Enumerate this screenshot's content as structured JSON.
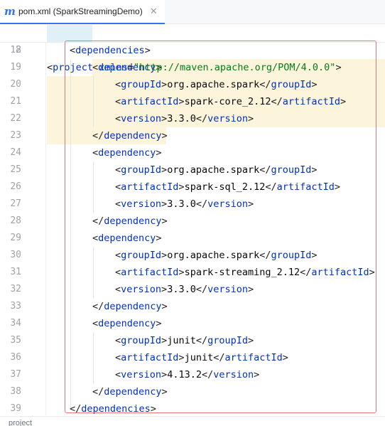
{
  "tab": {
    "icon": "maven-icon",
    "icon_glyph": "m",
    "title": "pom.xml (SparkStreamingDemo)",
    "close_glyph": "✕"
  },
  "sticky_line": {
    "number": "2",
    "open": "<",
    "tag": "project",
    "attr": "xmlns",
    "eq": "=",
    "value": "\"http://maven.apache.org/POM/4.0.0\"",
    "close": ">"
  },
  "lines": [
    {
      "n": "18",
      "tag": "dependencies",
      "kind": "open",
      "indent": 1
    },
    {
      "n": "19",
      "tag": "dependency",
      "kind": "open",
      "indent": 2
    },
    {
      "n": "20",
      "tag": "groupId",
      "kind": "value",
      "text": "org.apache.spark",
      "indent": 3
    },
    {
      "n": "21",
      "tag": "artifactId",
      "kind": "value",
      "text": "spark-core_2.12",
      "indent": 3
    },
    {
      "n": "22",
      "tag": "version",
      "kind": "value",
      "text": "3.3.0",
      "indent": 3
    },
    {
      "n": "23",
      "tag": "dependency",
      "kind": "close",
      "indent": 2
    },
    {
      "n": "24",
      "tag": "dependency",
      "kind": "open",
      "indent": 2
    },
    {
      "n": "25",
      "tag": "groupId",
      "kind": "value",
      "text": "org.apache.spark",
      "indent": 3
    },
    {
      "n": "26",
      "tag": "artifactId",
      "kind": "value",
      "text": "spark-sql_2.12",
      "indent": 3
    },
    {
      "n": "27",
      "tag": "version",
      "kind": "value",
      "text": "3.3.0",
      "indent": 3
    },
    {
      "n": "28",
      "tag": "dependency",
      "kind": "close",
      "indent": 2
    },
    {
      "n": "29",
      "tag": "dependency",
      "kind": "open",
      "indent": 2
    },
    {
      "n": "30",
      "tag": "groupId",
      "kind": "value",
      "text": "org.apache.spark",
      "indent": 3
    },
    {
      "n": "31",
      "tag": "artifactId",
      "kind": "value",
      "text": "spark-streaming_2.12",
      "indent": 3
    },
    {
      "n": "32",
      "tag": "version",
      "kind": "value",
      "text": "3.3.0",
      "indent": 3
    },
    {
      "n": "33",
      "tag": "dependency",
      "kind": "close",
      "indent": 2
    },
    {
      "n": "34",
      "tag": "dependency",
      "kind": "open",
      "indent": 2
    },
    {
      "n": "35",
      "tag": "groupId",
      "kind": "value",
      "text": "junit",
      "indent": 3
    },
    {
      "n": "36",
      "tag": "artifactId",
      "kind": "value",
      "text": "junit",
      "indent": 3
    },
    {
      "n": "37",
      "tag": "version",
      "kind": "value",
      "text": "4.13.2",
      "indent": 3
    },
    {
      "n": "38",
      "tag": "dependency",
      "kind": "close",
      "indent": 2
    },
    {
      "n": "39",
      "tag": "dependencies",
      "kind": "close",
      "indent": 1
    }
  ],
  "status": {
    "breadcrumb": "project"
  },
  "colors": {
    "tag": "#0033b3",
    "attribute": "#174ad4",
    "string": "#067d17",
    "text": "#080808",
    "line_number": "#9ea1a6",
    "selection_frame": "#e8737a",
    "block_highlight": "#fdf4dc"
  }
}
